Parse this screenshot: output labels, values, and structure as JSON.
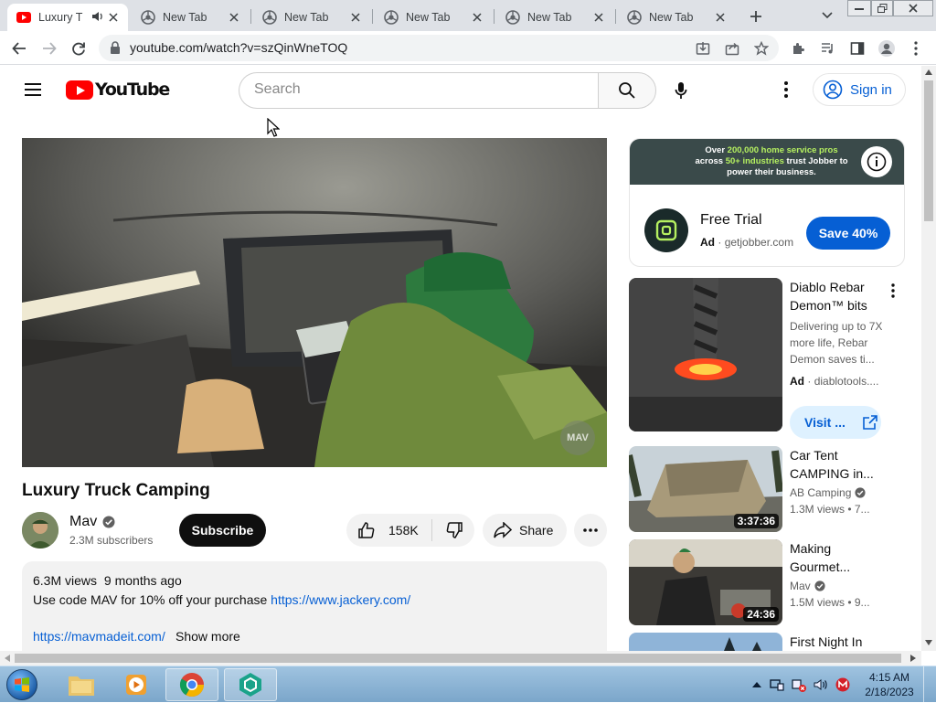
{
  "browser": {
    "tabs": [
      {
        "title": "Luxury T",
        "active": true
      },
      {
        "title": "New Tab"
      },
      {
        "title": "New Tab"
      },
      {
        "title": "New Tab"
      },
      {
        "title": "New Tab"
      },
      {
        "title": "New Tab"
      }
    ],
    "url": "youtube.com/watch?v=szQinWneTOQ"
  },
  "masthead": {
    "logo_text": "YouTube",
    "search_placeholder": "Search",
    "signin_label": "Sign in"
  },
  "video": {
    "watermark": "MAV",
    "title": "Luxury Truck Camping",
    "channel": "Mav",
    "subscribers": "2.3M subscribers",
    "subscribe_label": "Subscribe",
    "likes": "158K",
    "share_label": "Share",
    "description": {
      "views": "6.3M views",
      "age": "9 months ago",
      "line1_text": "Use code MAV for 10% off your purchase",
      "line1_link": "https://www.jackery.com/",
      "line2_link": "https://mavmadeit.com/",
      "show_more": "Show more"
    }
  },
  "ad": {
    "banner_pre": "Over",
    "banner_hl1": "200,000 home service pros",
    "banner_mid": "across",
    "banner_hl2": "50+ industries",
    "banner_post": "trust Jobber to power their business.",
    "title": "Free Trial",
    "label": "Ad",
    "domain": "getjobber.com",
    "cta": "Save 40%"
  },
  "sidebar": {
    "ad2": {
      "title_line1": "Diablo Rebar",
      "title_line2": "Demon™ bits",
      "desc_line1": "Delivering up to 7X",
      "desc_line2": "more life, Rebar",
      "desc_line3": "Demon saves ti...",
      "label": "Ad",
      "domain": "diablotools....",
      "cta": "Visit ..."
    },
    "videos": [
      {
        "title_line1": "Car Tent",
        "title_line2": "CAMPING in...",
        "channel": "AB Camping",
        "meta": "1.3M views  •  7...",
        "duration": "3:37:36"
      },
      {
        "title_line1": "Making",
        "title_line2": "Gourmet...",
        "channel": "Mav",
        "meta": "1.5M views  •  9...",
        "duration": "24:36"
      },
      {
        "title_line1": "First Night In",
        "title_line2": "",
        "channel": "",
        "meta": "",
        "duration": ""
      }
    ]
  },
  "taskbar": {
    "time": "4:15 AM",
    "date": "2/18/2023"
  }
}
